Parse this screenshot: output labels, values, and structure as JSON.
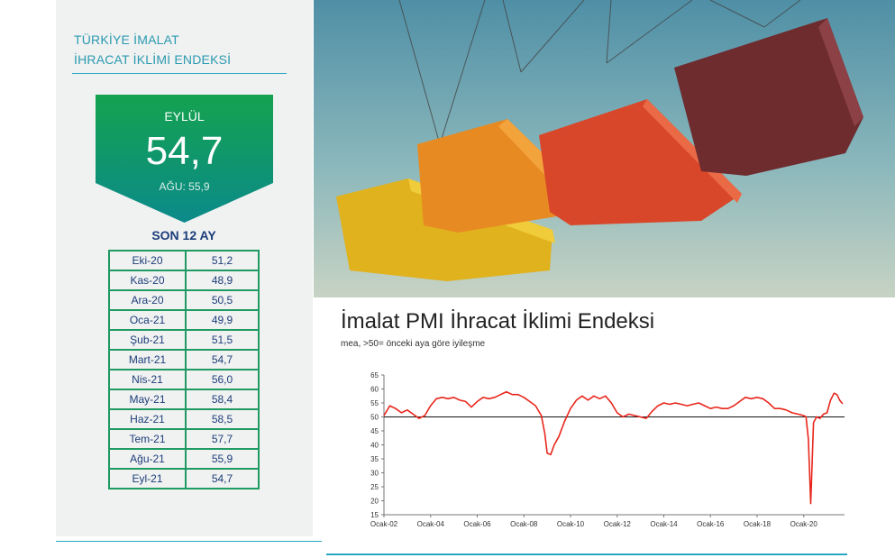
{
  "sidebar": {
    "title_line1": "TÜRKİYE İMALAT",
    "title_line2": "İHRACAT İKLİMİ ENDEKSİ",
    "badge": {
      "month": "EYLÜL",
      "value": "54,7",
      "previous": "AĞU: 55,9",
      "color": "#0e9a5c"
    },
    "last12_label": "SON 12 AY",
    "history": [
      {
        "month": "Eki-20",
        "value": "51,2"
      },
      {
        "month": "Kas-20",
        "value": "48,9"
      },
      {
        "month": "Ara-20",
        "value": "50,5"
      },
      {
        "month": "Oca-21",
        "value": "49,9"
      },
      {
        "month": "Şub-21",
        "value": "51,5"
      },
      {
        "month": "Mart-21",
        "value": "54,7"
      },
      {
        "month": "Nis-21",
        "value": "56,0"
      },
      {
        "month": "May-21",
        "value": "58,4"
      },
      {
        "month": "Haz-21",
        "value": "58,5"
      },
      {
        "month": "Tem-21",
        "value": "57,7"
      },
      {
        "month": "Ağu-21",
        "value": "55,9"
      },
      {
        "month": "Eyl-21",
        "value": "54,7"
      }
    ]
  },
  "photo": {
    "subject": "shipping containers hanging from crane cables"
  },
  "chart": {
    "title": "İmalat PMI İhracat İklimi Endeksi",
    "subtitle": "mea, >50= önceki aya göre iyileşme"
  },
  "chart_data": {
    "type": "line",
    "line_color": "#e8261c",
    "reference_line": 50,
    "ylim": [
      15,
      65
    ],
    "yticks": [
      15,
      20,
      25,
      30,
      35,
      40,
      45,
      50,
      55,
      60,
      65
    ],
    "xlim": [
      2002.0,
      2021.75
    ],
    "xtick_labels": [
      "Ocak-02",
      "Ocak-04",
      "Ocak-06",
      "Ocak-08",
      "Ocak-10",
      "Ocak-12",
      "Ocak-14",
      "Ocak-16",
      "Ocak-18",
      "Ocak-20"
    ],
    "xtick_years": [
      2002,
      2004,
      2006,
      2008,
      2010,
      2012,
      2014,
      2016,
      2018,
      2020
    ],
    "series": [
      {
        "x": [
          2002.0,
          2002.25,
          2002.5,
          2002.75,
          2003.0,
          2003.25,
          2003.5,
          2003.75,
          2004.0,
          2004.25,
          2004.5,
          2004.75,
          2005.0,
          2005.25,
          2005.5,
          2005.75,
          2006.0,
          2006.25,
          2006.5,
          2006.75,
          2007.0,
          2007.25,
          2007.5,
          2007.75,
          2008.0,
          2008.25,
          2008.5,
          2008.75,
          2008.9,
          2009.0,
          2009.15,
          2009.3,
          2009.5,
          2009.75,
          2010.0,
          2010.25,
          2010.5,
          2010.75,
          2011.0,
          2011.25,
          2011.5,
          2011.75,
          2012.0,
          2012.25,
          2012.5,
          2012.75,
          2013.0,
          2013.25,
          2013.5,
          2013.75,
          2014.0,
          2014.25,
          2014.5,
          2014.75,
          2015.0,
          2015.25,
          2015.5,
          2015.75,
          2016.0,
          2016.25,
          2016.5,
          2016.75,
          2017.0,
          2017.25,
          2017.5,
          2017.75,
          2018.0,
          2018.25,
          2018.5,
          2018.75,
          2019.0,
          2019.25,
          2019.5,
          2019.75,
          2020.0,
          2020.1,
          2020.2,
          2020.3,
          2020.42,
          2020.55,
          2020.7,
          2020.85,
          2021.0,
          2021.15,
          2021.3,
          2021.42,
          2021.55,
          2021.67
        ],
        "y": [
          50.5,
          54.0,
          53.0,
          51.5,
          52.5,
          51.0,
          49.5,
          50.5,
          54.0,
          56.5,
          57.0,
          56.5,
          57.0,
          56.0,
          55.5,
          53.5,
          55.5,
          57.0,
          56.5,
          57.0,
          58.0,
          59.0,
          58.0,
          58.0,
          57.0,
          55.5,
          54.0,
          50.5,
          44.0,
          37.0,
          36.5,
          40.0,
          43.0,
          48.5,
          53.0,
          56.0,
          57.5,
          56.0,
          57.5,
          56.5,
          57.5,
          55.0,
          51.5,
          50.0,
          51.0,
          50.5,
          50.0,
          49.5,
          52.0,
          54.0,
          55.0,
          54.5,
          55.0,
          54.5,
          54.0,
          54.5,
          55.0,
          54.0,
          53.0,
          53.5,
          53.0,
          53.0,
          54.0,
          55.5,
          57.0,
          56.5,
          57.0,
          56.5,
          55.0,
          53.0,
          53.0,
          52.5,
          51.5,
          51.0,
          50.5,
          50.0,
          42.0,
          19.0,
          48.0,
          50.0,
          49.5,
          51.0,
          51.5,
          56.0,
          58.5,
          58.0,
          55.9,
          54.7
        ]
      }
    ]
  }
}
